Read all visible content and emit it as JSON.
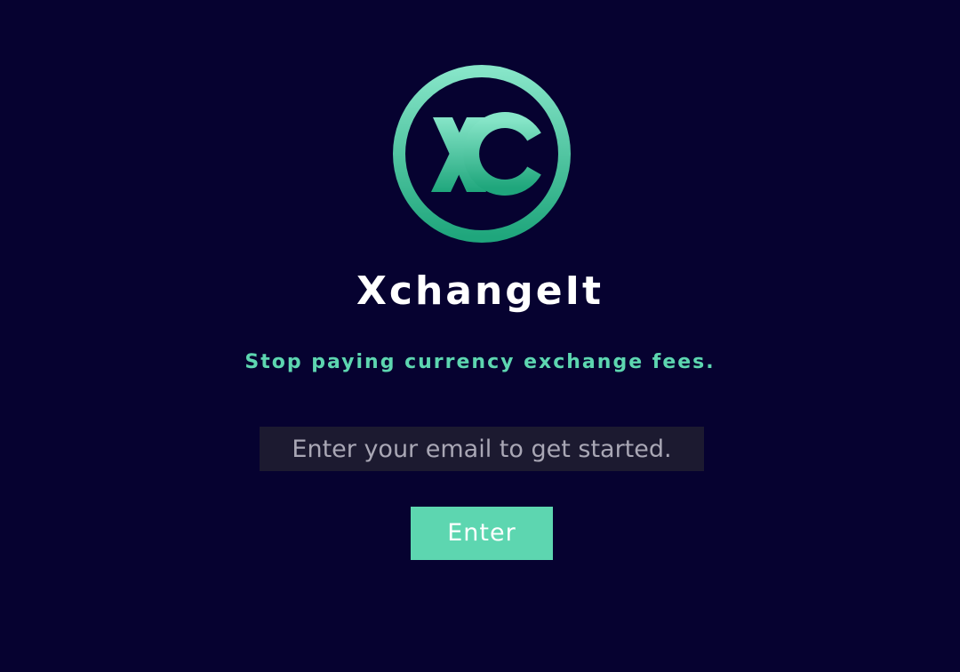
{
  "app": {
    "logo_icon": "xc-monogram-icon",
    "brand_name": "XchangeIt",
    "tagline": "Stop paying currency exchange fees."
  },
  "signup": {
    "email_placeholder": "Enter your email to get started.",
    "email_value": "",
    "enter_label": "Enter"
  },
  "colors": {
    "background": "#060230",
    "accent": "#5dd6b0",
    "input_background": "#1c1a30"
  }
}
